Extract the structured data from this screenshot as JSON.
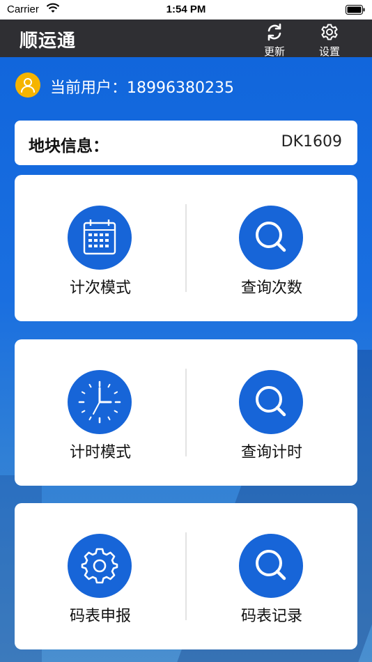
{
  "status_bar": {
    "carrier": "Carrier",
    "time": "1:54 PM"
  },
  "nav": {
    "title": "顺运通",
    "refresh_label": "更新",
    "settings_label": "设置"
  },
  "user": {
    "label": "当前用户：",
    "phone": "18996380235"
  },
  "plot": {
    "label": "地块信息：",
    "value": "DK1609"
  },
  "cards": [
    {
      "left_label": "计次模式",
      "right_label": "查询次数"
    },
    {
      "left_label": "计时模式",
      "right_label": "查询计时"
    },
    {
      "left_label": "码表申报",
      "right_label": "码表记录"
    }
  ],
  "colors": {
    "primary": "#1765d8",
    "navbar": "#2f2f33",
    "avatar": "#f5b400"
  },
  "icons": {
    "card1_left": "calendar-icon",
    "card1_right": "search-icon",
    "card2_left": "clock-icon",
    "card2_right": "search-icon",
    "card3_left": "gear-icon",
    "card3_right": "search-icon"
  }
}
